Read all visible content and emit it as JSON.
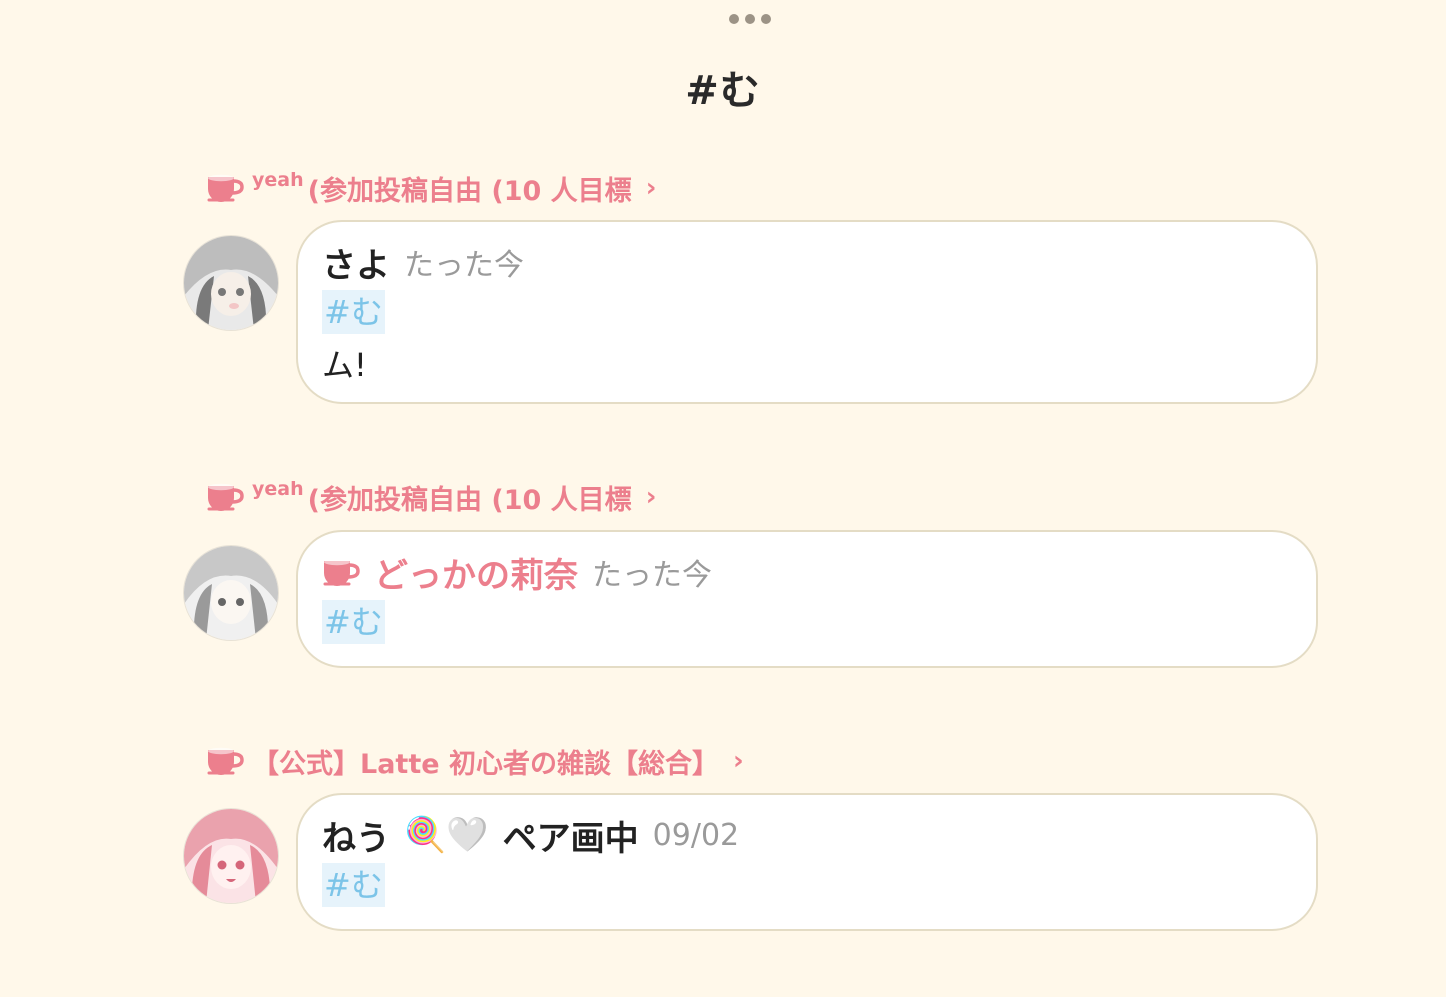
{
  "header": {
    "title": "#む"
  },
  "posts": [
    {
      "room_prefix": "yeah",
      "room": "(参加投稿自由 (10 人目標",
      "room_chevron": "›",
      "author": "さよ",
      "time": "たった今",
      "tag": "#む",
      "text": "ム!"
    },
    {
      "room_prefix": "yeah",
      "room": "(参加投稿自由 (10 人目標",
      "room_chevron": "›",
      "author": "どっかの莉奈",
      "time": "たった今",
      "tag": "#む",
      "author_color": "#ec7f8d"
    },
    {
      "room": "【公式】Latte 初心者の雑談【総合】",
      "room_chevron": "›",
      "author": "ねう",
      "author_emojis": "🍭🤍",
      "author_suffix": "ペア画中",
      "time": "09/02",
      "tag": "#む"
    }
  ],
  "colors": {
    "background": "#fff8ea",
    "accent_pink": "#ec7f8d",
    "hashtag_blue": "#7cc4e8",
    "hashtag_bg": "#e6f3fb"
  },
  "icons": [
    "more-dots-icon",
    "coffee-cup-icon",
    "chevron-right-icon"
  ]
}
